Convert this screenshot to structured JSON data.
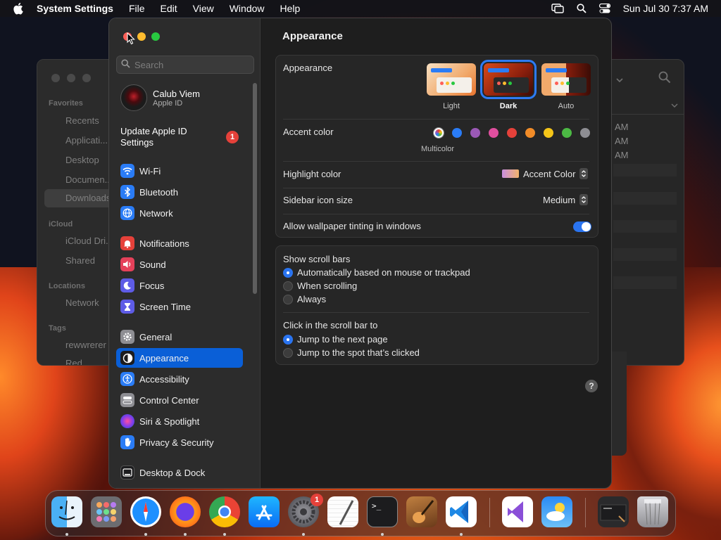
{
  "menubar": {
    "app_name": "System Settings",
    "menus": [
      "File",
      "Edit",
      "View",
      "Window",
      "Help"
    ],
    "datetime": "Sun Jul 30  7:37 AM",
    "icons": [
      "apple-logo-icon",
      "screen-mirroring-icon",
      "spotlight-search-icon",
      "control-center-icon"
    ]
  },
  "finder": {
    "sections": {
      "favorites": "Favorites",
      "icloud": "iCloud",
      "locations": "Locations",
      "tags": "Tags"
    },
    "items": {
      "recents": "Recents",
      "applications": "Applicati...",
      "desktop": "Desktop",
      "documents": "Documen...",
      "downloads": "Downloads",
      "icloud_drive": "iCloud Dri...",
      "shared": "Shared",
      "network": "Network",
      "tag1": "rewwrerer",
      "tag2": "Red"
    },
    "times": [
      "AM",
      "AM",
      "AM"
    ]
  },
  "sidebar": {
    "search_placeholder": "Search",
    "account_name": "Calub Viem",
    "account_sub": "Apple ID",
    "update_label": "Update Apple ID Settings",
    "update_badge": "1",
    "items": [
      {
        "label": "Wi-Fi",
        "icon": "wifi-icon",
        "color": "#2a7cf6"
      },
      {
        "label": "Bluetooth",
        "icon": "bluetooth-icon",
        "color": "#2a7cf6"
      },
      {
        "label": "Network",
        "icon": "globe-icon",
        "color": "#2a7cf6"
      },
      {
        "label": "Notifications",
        "icon": "bell-icon",
        "color": "#e5413a"
      },
      {
        "label": "Sound",
        "icon": "speaker-icon",
        "color": "#e5415a"
      },
      {
        "label": "Focus",
        "icon": "moon-icon",
        "color": "#5e5ce6"
      },
      {
        "label": "Screen Time",
        "icon": "hourglass-icon",
        "color": "#5e5ce6"
      },
      {
        "label": "General",
        "icon": "gear-icon",
        "color": "#8e8e93"
      },
      {
        "label": "Appearance",
        "icon": "appearance-icon",
        "color": "#1c1c1e"
      },
      {
        "label": "Accessibility",
        "icon": "accessibility-icon",
        "color": "#2a7cf6"
      },
      {
        "label": "Control Center",
        "icon": "control-center-icon",
        "color": "#8e8e93"
      },
      {
        "label": "Siri & Spotlight",
        "icon": "siri-icon",
        "color": "#b04ad8"
      },
      {
        "label": "Privacy & Security",
        "icon": "hand-icon",
        "color": "#2a7cf6"
      },
      {
        "label": "Desktop & Dock",
        "icon": "dock-icon",
        "color": "#1c1c1e"
      }
    ],
    "selected": "Appearance"
  },
  "content": {
    "title": "Appearance",
    "appearance_label": "Appearance",
    "modes": [
      "Light",
      "Dark",
      "Auto"
    ],
    "selected_mode": "Dark",
    "accent_label": "Accent color",
    "accent_caption": "Multicolor",
    "accent_colors": [
      "multicolor",
      "#2a7cf6",
      "#9b59b6",
      "#e04f9f",
      "#e5413a",
      "#f28c28",
      "#f5c518",
      "#4cb944",
      "#8e8e93"
    ],
    "highlight_label": "Highlight color",
    "highlight_value": "Accent Color",
    "sidebar_size_label": "Sidebar icon size",
    "sidebar_size_value": "Medium",
    "tinting_label": "Allow wallpaper tinting in windows",
    "tinting_on": true,
    "scroll_title": "Show scroll bars",
    "scroll_options": [
      "Automatically based on mouse or trackpad",
      "When scrolling",
      "Always"
    ],
    "scroll_selected": 0,
    "click_title": "Click in the scroll bar to",
    "click_options": [
      "Jump to the next page",
      "Jump to the spot that’s clicked"
    ],
    "click_selected": 0,
    "help_label": "?"
  },
  "dock": {
    "apps": [
      "finder-icon",
      "launchpad-icon",
      "safari-icon",
      "firefox-icon",
      "chrome-icon",
      "app-store-icon",
      "system-settings-icon",
      "textedit-icon",
      "terminal-icon",
      "garageband-icon",
      "vscode-icon",
      "visual-studio-icon",
      "weather-icon",
      "screenshot-icon",
      "trash-icon"
    ],
    "settings_badge": "1",
    "terminal_prompt": ">_"
  }
}
